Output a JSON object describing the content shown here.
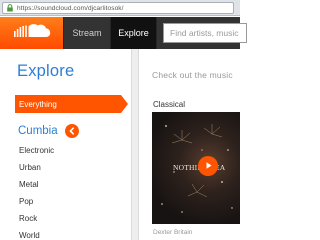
{
  "browser": {
    "url": "https://soundcloud.com/djcarlitosok/"
  },
  "header": {
    "logo_icon": "soundcloud-cloud-icon",
    "nav": [
      {
        "label": "Stream"
      },
      {
        "label": "Explore"
      }
    ],
    "search": {
      "placeholder": "Find artists, music"
    }
  },
  "sidebar": {
    "title": "Explore",
    "active_category": "Everything",
    "genre": "Cumbia",
    "back_icon": "chevron-left-icon",
    "categories": [
      "Electronic",
      "Urban",
      "Metal",
      "Pop",
      "Rock",
      "World"
    ]
  },
  "main": {
    "checkout_text": "Check out the music",
    "section_label": "Classical",
    "track": {
      "art_caption": "NOTHING FEA",
      "play_icon": "play-icon",
      "artist": "Dexter Britain"
    }
  },
  "colors": {
    "accent": "#ff5500",
    "link_blue": "#2e7fd4",
    "header_bg": "#333333"
  }
}
